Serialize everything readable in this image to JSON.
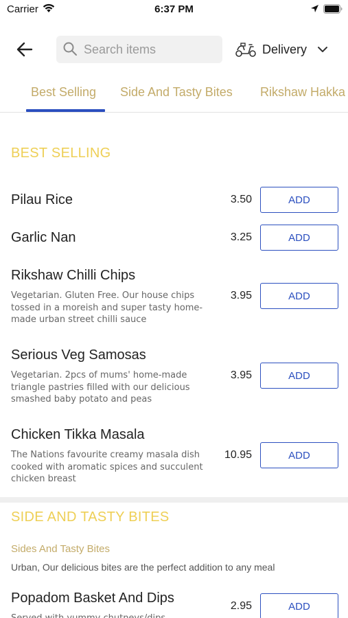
{
  "status_bar": {
    "carrier": "Carrier",
    "time": "6:37 PM"
  },
  "header": {
    "search_placeholder": "Search items",
    "delivery_label": "Delivery"
  },
  "tabs": [
    {
      "label": "Best Selling",
      "active": true
    },
    {
      "label": "Side And Tasty Bites",
      "active": false
    },
    {
      "label": "Rikshaw Hakka",
      "active": false
    }
  ],
  "sections": [
    {
      "title": "BEST SELLING",
      "items": [
        {
          "name": "Pilau Rice",
          "description": "",
          "price": "3.50",
          "add_label": "ADD"
        },
        {
          "name": "Garlic Nan",
          "description": "",
          "price": "3.25",
          "add_label": "ADD"
        },
        {
          "name": "Rikshaw Chilli Chips",
          "description": "Vegetarian. Gluten Free. Our house chips tossed in a moreish and super tasty home-made urban street chilli sauce",
          "price": "3.95",
          "add_label": "ADD"
        },
        {
          "name": "Serious Veg Samosas",
          "description": "Vegetarian. 2pcs of mums' home-made triangle pastries filled with our delicious smashed baby potato and peas",
          "price": "3.95",
          "add_label": "ADD"
        },
        {
          "name": "Chicken Tikka Masala",
          "description": "The Nations favourite creamy masala dish cooked with aromatic spices and succulent chicken breast",
          "price": "10.95",
          "add_label": "ADD"
        }
      ]
    },
    {
      "title": "SIDE AND TASTY BITES",
      "subtitle": "Sides And Tasty Bites",
      "description": "Urban, Our delicious bites are the perfect addition to any meal",
      "items": [
        {
          "name": "Popadom Basket And Dips",
          "description": "Served with yummy chutneys/dips",
          "price": "2.95",
          "add_label": "ADD"
        }
      ]
    }
  ],
  "colors": {
    "accent_blue": "#2b4fbf",
    "section_gold": "#eecf55",
    "tab_gold": "#c3ab69"
  },
  "icons": [
    "wifi-icon",
    "location-arrow-icon",
    "battery-icon",
    "back-arrow-icon",
    "search-icon",
    "scooter-icon",
    "chevron-down-icon"
  ]
}
